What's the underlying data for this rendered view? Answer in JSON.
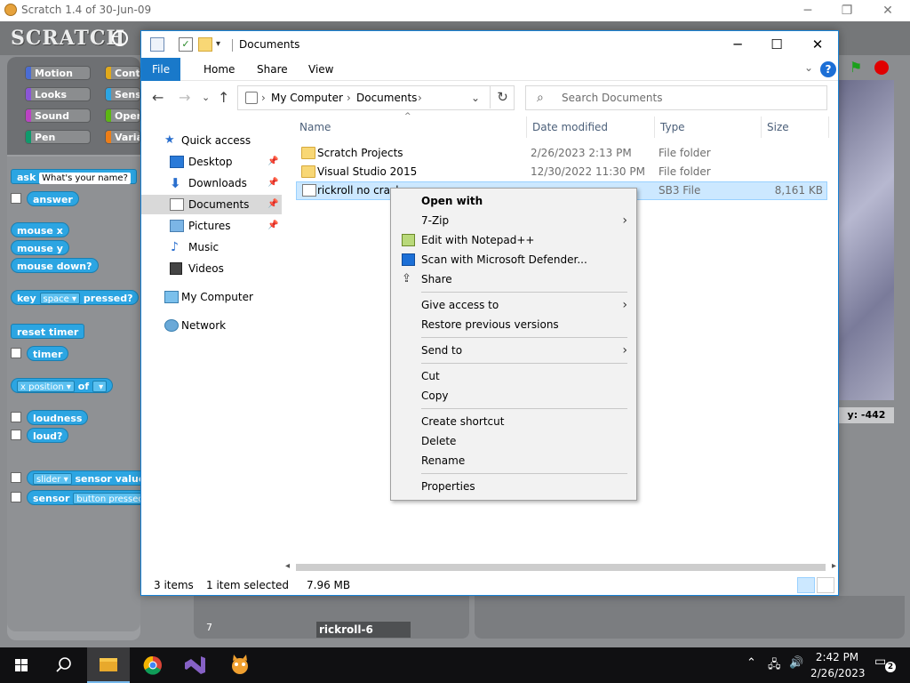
{
  "scratch": {
    "title": "Scratch 1.4 of 30-Jun-09",
    "logo": "SCRATCH",
    "categories": [
      {
        "label": "Motion",
        "color": "#4a6cd4"
      },
      {
        "label": "Control",
        "color": "#e1a91a"
      },
      {
        "label": "Looks",
        "color": "#8a55d7"
      },
      {
        "label": "Sensing",
        "color": "#2ca5e2"
      },
      {
        "label": "Sound",
        "color": "#bb42c3"
      },
      {
        "label": "Operators",
        "color": "#5cb712"
      },
      {
        "label": "Pen",
        "color": "#0e9a6c"
      },
      {
        "label": "Variables",
        "color": "#ee7d16"
      }
    ],
    "blocks": {
      "ask": "ask",
      "ask_default": "What's your name?",
      "answer": "answer",
      "mouse_x": "mouse x",
      "mouse_y": "mouse y",
      "mouse_down": "mouse down?",
      "key": "key",
      "key_slot": "space",
      "pressed": "pressed?",
      "reset_timer": "reset timer",
      "timer": "timer",
      "x_position": "x position",
      "of": "of",
      "loudness": "loudness",
      "loud": "loud?",
      "slider": "slider",
      "sensor_value": "sensor value",
      "sensor": "sensor",
      "button_pressed": "button pressed"
    },
    "stage_y_readout": "y: -442",
    "sprite_number": "7",
    "sprite_name": "rickroll-6"
  },
  "explorer": {
    "title": "Documents",
    "ribbon_tabs": [
      "File",
      "Home",
      "Share",
      "View"
    ],
    "address": {
      "root": "My Computer",
      "folder": "Documents"
    },
    "search_placeholder": "Search Documents",
    "nav": [
      {
        "label": "Quick access",
        "pinned": false
      },
      {
        "label": "Desktop",
        "pinned": true
      },
      {
        "label": "Downloads",
        "pinned": true
      },
      {
        "label": "Documents",
        "pinned": true
      },
      {
        "label": "Pictures",
        "pinned": true
      },
      {
        "label": "Music",
        "pinned": false
      },
      {
        "label": "Videos",
        "pinned": false
      },
      {
        "label": "My Computer",
        "pinned": false
      },
      {
        "label": "Network",
        "pinned": false
      }
    ],
    "columns": [
      "Name",
      "Date modified",
      "Type",
      "Size"
    ],
    "files": [
      {
        "name": "Scratch Projects",
        "date": "2/26/2023 2:13 PM",
        "type": "File folder",
        "size": ""
      },
      {
        "name": "Visual Studio 2015",
        "date": "12/30/2022 11:30 PM",
        "type": "File folder",
        "size": ""
      },
      {
        "name": "rickroll no crash",
        "date": "",
        "type": "SB3 File",
        "size": "8,161 KB"
      }
    ],
    "status": {
      "items": "3 items",
      "selected": "1 item selected",
      "size": "7.96 MB"
    }
  },
  "context_menu": {
    "items": [
      {
        "label": "Open with",
        "bold": true,
        "submenu": false
      },
      {
        "label": "7-Zip",
        "bold": false,
        "submenu": true
      },
      {
        "label": "Edit with Notepad++",
        "bold": false,
        "submenu": false,
        "icon": "notepad-icon"
      },
      {
        "label": "Scan with Microsoft Defender...",
        "bold": false,
        "submenu": false,
        "icon": "defender-icon"
      },
      {
        "label": "Share",
        "bold": false,
        "submenu": false,
        "icon": "share-icon"
      },
      {
        "label": "Give access to",
        "bold": false,
        "submenu": true
      },
      {
        "label": "Restore previous versions",
        "bold": false,
        "submenu": false
      },
      {
        "label": "Send to",
        "bold": false,
        "submenu": true
      },
      {
        "label": "Cut",
        "bold": false,
        "submenu": false
      },
      {
        "label": "Copy",
        "bold": false,
        "submenu": false
      },
      {
        "label": "Create shortcut",
        "bold": false,
        "submenu": false
      },
      {
        "label": "Delete",
        "bold": false,
        "submenu": false
      },
      {
        "label": "Rename",
        "bold": false,
        "submenu": false
      },
      {
        "label": "Properties",
        "bold": false,
        "submenu": false
      }
    ]
  },
  "taskbar": {
    "time": "2:42 PM",
    "date": "2/26/2023",
    "notification_count": "2"
  }
}
